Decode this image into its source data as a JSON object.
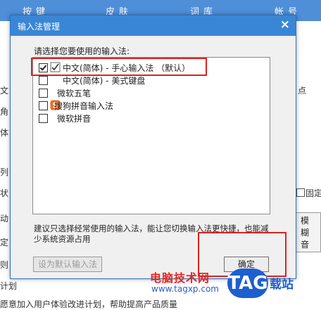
{
  "background": {
    "tabs": [
      "按键",
      "皮肤",
      "词库",
      "帐号"
    ],
    "fragments": {
      "left1": "文",
      "left2": "角",
      "left3": "体",
      "left4": "列",
      "left5": "状",
      "left6": "动",
      "left7": "定",
      "left8": "则",
      "right_dian": "点",
      "plan_label": "计划",
      "plan_text": "愿意加入用户体验改进计划，帮助提高产品质量",
      "fixed_pos": "固定能",
      "fuzzy": "模糊音"
    }
  },
  "dialog": {
    "title": "输入法管理",
    "close_glyph": "×",
    "prompt": "请选择您要使用的输入法:",
    "items": [
      {
        "label": "中文(简体) - 手心输入法 （默认）",
        "checked": true,
        "icon": "handwriting-pen-icon"
      },
      {
        "label": "中文(简体) - 美式键盘",
        "checked": false,
        "icon": ""
      },
      {
        "label": "微软五笔",
        "checked": false,
        "icon": ""
      },
      {
        "label": "搜狗拼音输入法",
        "checked": false,
        "icon": "sogou-s-icon"
      },
      {
        "label": "微软拼音",
        "checked": false,
        "icon": ""
      }
    ],
    "hint": "建议只选择经常使用的输入法，能让您切换输入法更快捷，也能减少系统资源占用",
    "set_default_label": "设为默认输入法",
    "ok_label": "确定"
  },
  "watermark": {
    "text": "电脑技术网",
    "url": "www.tagxp.com",
    "tag": "TAG",
    "zhan": "载站"
  },
  "colors": {
    "titlebar": "#3a86d6",
    "highlight": "#e02020",
    "sogou": "#f26c21"
  }
}
